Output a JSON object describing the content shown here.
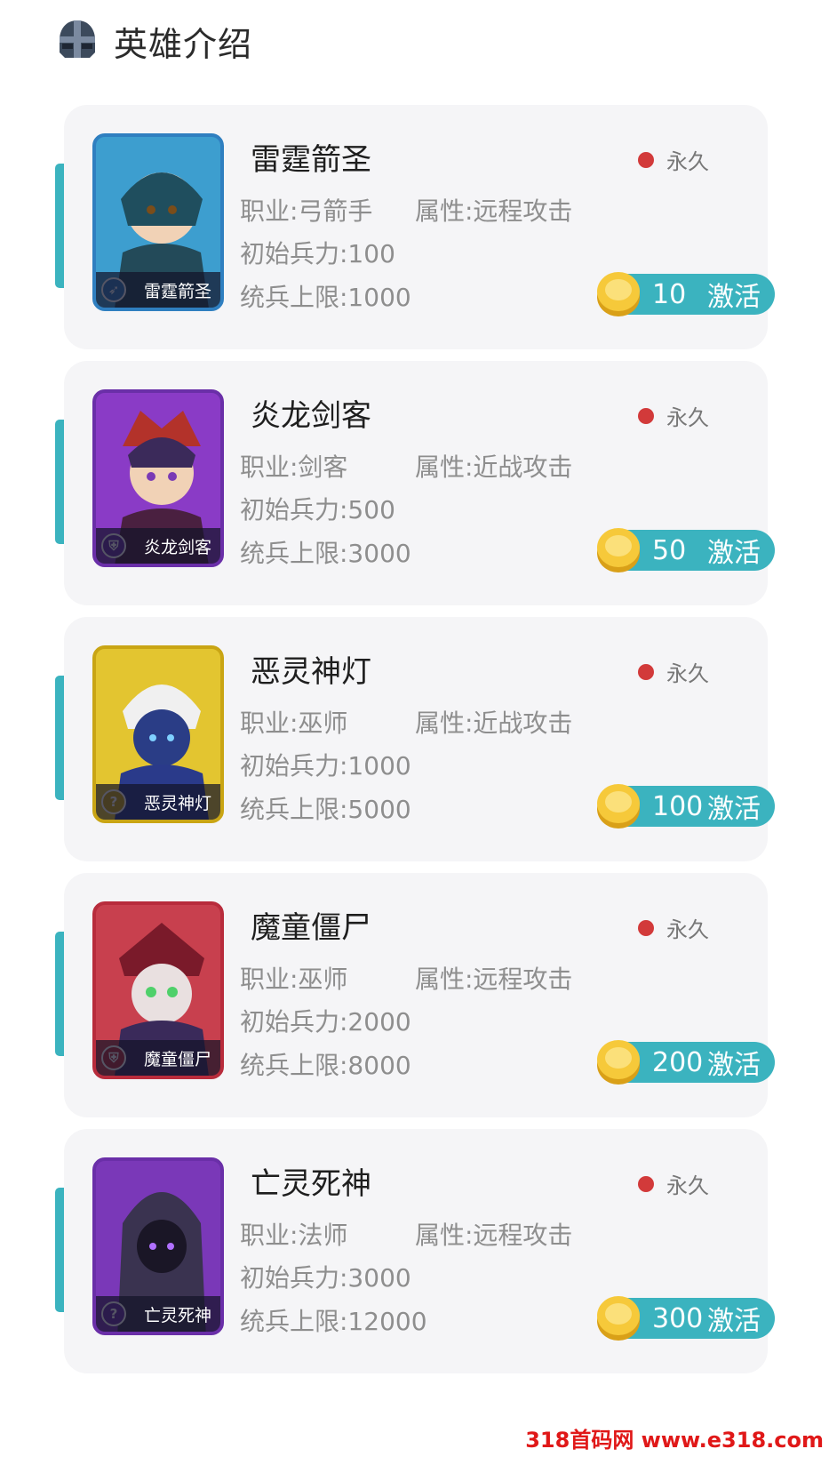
{
  "header": {
    "title": "英雄介绍",
    "icon": "helmet-icon"
  },
  "labels": {
    "job_prefix": "职业:",
    "attr_prefix": "属性:",
    "troops_prefix": "初始兵力:",
    "limit_prefix": "统兵上限:",
    "activate": "激活",
    "permanent": "永久"
  },
  "heroes": [
    {
      "name": "雷霆箭圣",
      "job": "职业:弓箭手",
      "attr": "属性:远程攻击",
      "troops": "初始兵力:100",
      "limit": "统兵上限:1000",
      "price": "10",
      "action": "激活",
      "duration": "永久",
      "frame_color": "#2f7fc0",
      "bg_color": "#3d9ecf",
      "badge": "bow-icon"
    },
    {
      "name": "炎龙剑客",
      "job": "职业:剑客",
      "attr": "属性:近战攻击",
      "troops": "初始兵力:500",
      "limit": "统兵上限:3000",
      "price": "50",
      "action": "激活",
      "duration": "永久",
      "frame_color": "#6a2fa8",
      "bg_color": "#8a3bc6",
      "badge": "helmet-icon"
    },
    {
      "name": "恶灵神灯",
      "job": "职业:巫师",
      "attr": "属性:近战攻击",
      "troops": "初始兵力:1000",
      "limit": "统兵上限:5000",
      "price": "100",
      "action": "激活",
      "duration": "永久",
      "frame_color": "#c9a514",
      "bg_color": "#e3c530",
      "badge": "magic-icon"
    },
    {
      "name": "魔童僵尸",
      "job": "职业:巫师",
      "attr": "属性:远程攻击",
      "troops": "初始兵力:2000",
      "limit": "统兵上限:8000",
      "price": "200",
      "action": "激活",
      "duration": "永久",
      "frame_color": "#b82c3c",
      "bg_color": "#c8404e",
      "badge": "helmet-icon"
    },
    {
      "name": "亡灵死神",
      "job": "职业:法师",
      "attr": "属性:远程攻击",
      "troops": "初始兵力:3000",
      "limit": "统兵上限:12000",
      "price": "300",
      "action": "激活",
      "duration": "永久",
      "frame_color": "#6a2fa8",
      "bg_color": "#7a38b8",
      "badge": "magic-icon"
    }
  ],
  "watermark": "318首码网 www.e318.com"
}
